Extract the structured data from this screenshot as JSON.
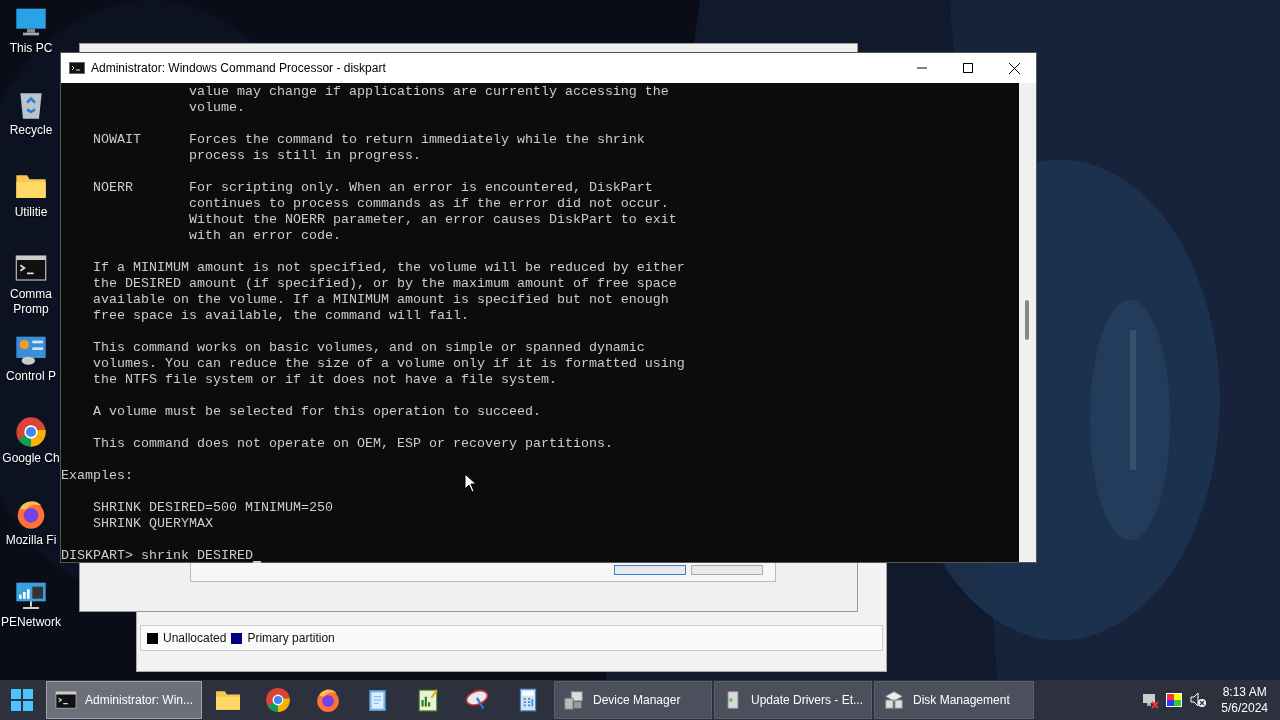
{
  "desktop_icons": [
    {
      "label": "This PC",
      "kind": "monitor"
    },
    {
      "label": "Recycle",
      "kind": "bin"
    },
    {
      "label": "Utilitie",
      "kind": "folder"
    },
    {
      "label": "Comma\nPromp",
      "kind": "console"
    },
    {
      "label": "Control P",
      "kind": "panel"
    },
    {
      "label": "Google Ch",
      "kind": "chrome"
    },
    {
      "label": "Mozilla Fi",
      "kind": "firefox"
    },
    {
      "label": "PENetwork",
      "kind": "network"
    }
  ],
  "disk_management": {
    "legend": [
      {
        "label": "Unallocated",
        "color": "#000000"
      },
      {
        "label": "Primary partition",
        "color": "#000080"
      }
    ]
  },
  "console_window": {
    "title": "Administrator: Windows Command Processor - diskpart",
    "blocks": [
      [
        "                value may change if applications are currently accessing the",
        "                volume."
      ],
      [
        "    NOWAIT      Forces the command to return immediately while the shrink",
        "                process is still in progress."
      ],
      [
        "    NOERR       For scripting only. When an error is encountered, DiskPart",
        "                continues to process commands as if the error did not occur.",
        "                Without the NOERR parameter, an error causes DiskPart to exit",
        "                with an error code."
      ],
      [
        "    If a MINIMUM amount is not specified, the volume will be reduced by either",
        "    the DESIRED amount (if specified), or by the maximum amount of free space",
        "    available on the volume. If a MINIMUM amount is specified but not enough",
        "    free space is available, the command will fail."
      ],
      [
        "    This command works on basic volumes, and on simple or spanned dynamic",
        "    volumes. You can reduce the size of a volume only if it is formatted using",
        "    the NTFS file system or if it does not have a file system."
      ],
      [
        "    A volume must be selected for this operation to succeed."
      ],
      [
        "    This command does not operate on OEM, ESP or recovery partitions."
      ],
      [
        "Examples:"
      ],
      [
        "    SHRINK DESIRED=500 MINIMUM=250",
        "    SHRINK QUERYMAX"
      ]
    ],
    "prompt": "DISKPART> shrink DESIRED"
  },
  "taskbar": {
    "windows": [
      {
        "label": "Administrator: Win...",
        "kind": "console",
        "selected": true
      }
    ],
    "pinned": [
      {
        "kind": "folder"
      },
      {
        "kind": "chrome"
      },
      {
        "kind": "firefox"
      },
      {
        "kind": "notepad"
      },
      {
        "kind": "chart"
      },
      {
        "kind": "satellite"
      },
      {
        "kind": "calculator"
      }
    ],
    "tasks": [
      {
        "label": "Device Manager",
        "kind": "devices",
        "selected": false
      },
      {
        "label": "Update Drivers - Et...",
        "kind": "drive",
        "selected": false
      },
      {
        "label": "Disk Management",
        "kind": "disks",
        "selected": false
      }
    ],
    "time": "8:13 AM",
    "date": "5/6/2024"
  }
}
